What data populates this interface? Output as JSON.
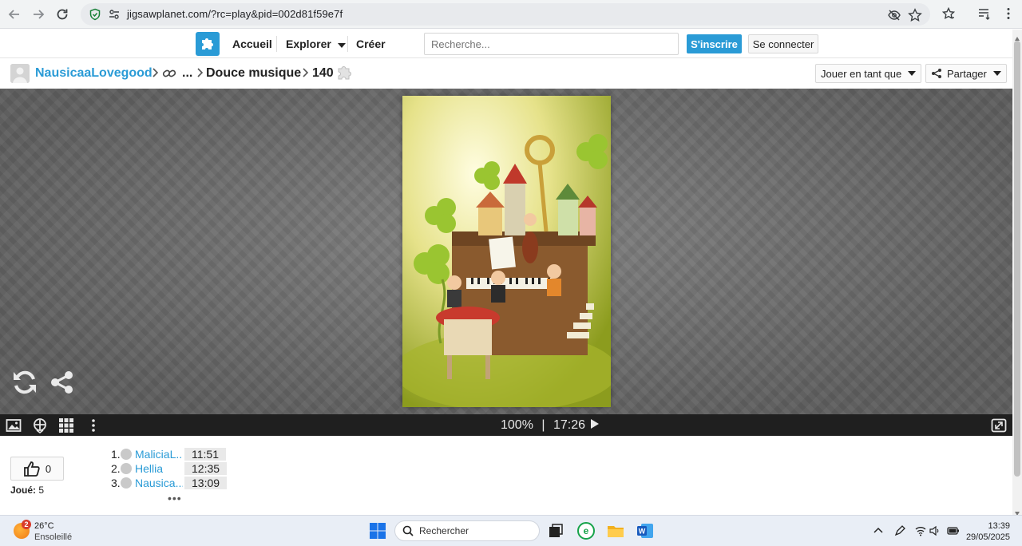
{
  "browser": {
    "url": "jigsawplanet.com/?rc=play&pid=002d81f59e7f"
  },
  "header": {
    "nav": [
      "Accueil",
      "Explorer",
      "Créer"
    ],
    "search_placeholder": "Recherche...",
    "signup_label": "S'inscrire",
    "login_label": "Se connecter"
  },
  "breadcrumb": {
    "user": "NausicaaLovegood",
    "ellipsis": "...",
    "title": "Douce musique",
    "pieces": "140",
    "play_as_label": "Jouer en tant que",
    "share_label": "Partager"
  },
  "game": {
    "zoom": "100%",
    "separator": "|",
    "time": "17:26"
  },
  "stats": {
    "likes": "0",
    "played_label": "Joué:",
    "played_count": "5",
    "scores": [
      {
        "rank": "1.",
        "name": "MaliciaL...",
        "time": "11:51"
      },
      {
        "rank": "2.",
        "name": "Hellia",
        "time": "12:35"
      },
      {
        "rank": "3.",
        "name": "Nausica...",
        "time": "13:09"
      }
    ],
    "more": "•••"
  },
  "taskbar": {
    "weather_badge": "2",
    "temperature": "26°C",
    "weather_desc": "Ensoleillé",
    "search_label": "Rechercher",
    "time": "13:39",
    "date": "29/05/2025"
  },
  "colors": {
    "accent": "#2a9bd6",
    "board": "#6f6f6f",
    "gamebar": "#1f1f1f"
  }
}
